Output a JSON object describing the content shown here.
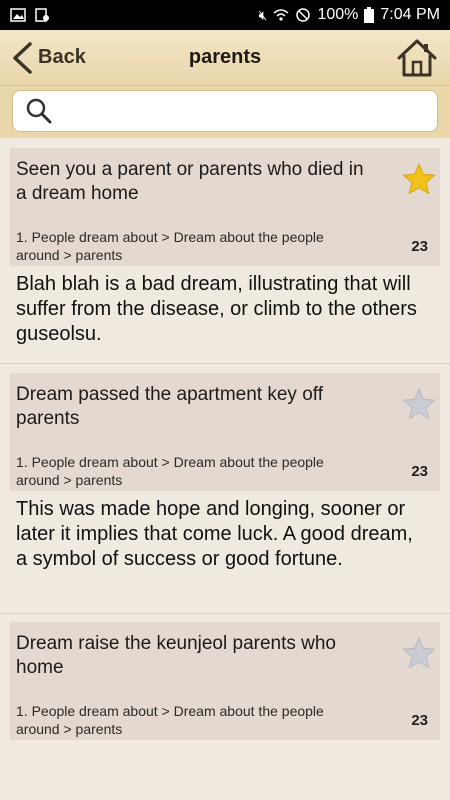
{
  "status_bar": {
    "battery": "100%",
    "time": "7:04 PM"
  },
  "header": {
    "back_label": "Back",
    "title": "parents"
  },
  "search": {
    "placeholder": "",
    "value": ""
  },
  "results": [
    {
      "title": "Seen you a parent or parents who died in a dream home",
      "path": "1. People dream about > Dream about the people around > parents",
      "count": "23",
      "favorited": true,
      "body": "Blah blah is a bad dream, illustrating that will suffer from the disease, or climb to the others guseolsu."
    },
    {
      "title": "Dream passed the apartment key off parents",
      "path": "1. People dream about > Dream about the people around > parents",
      "count": "23",
      "favorited": false,
      "body": "This was made hope and longing, sooner or later it implies that come luck. A good dream, a symbol of success or good fortune."
    },
    {
      "title": "Dream raise the keunjeol parents who home",
      "path": "1. People dream about > Dream about the people around > parents",
      "count": "23",
      "favorited": false,
      "body": ""
    }
  ],
  "colors": {
    "star_active": "#f2c21a",
    "star_inactive": "#c9ccd3",
    "header_bg": "#ecdcb6"
  }
}
